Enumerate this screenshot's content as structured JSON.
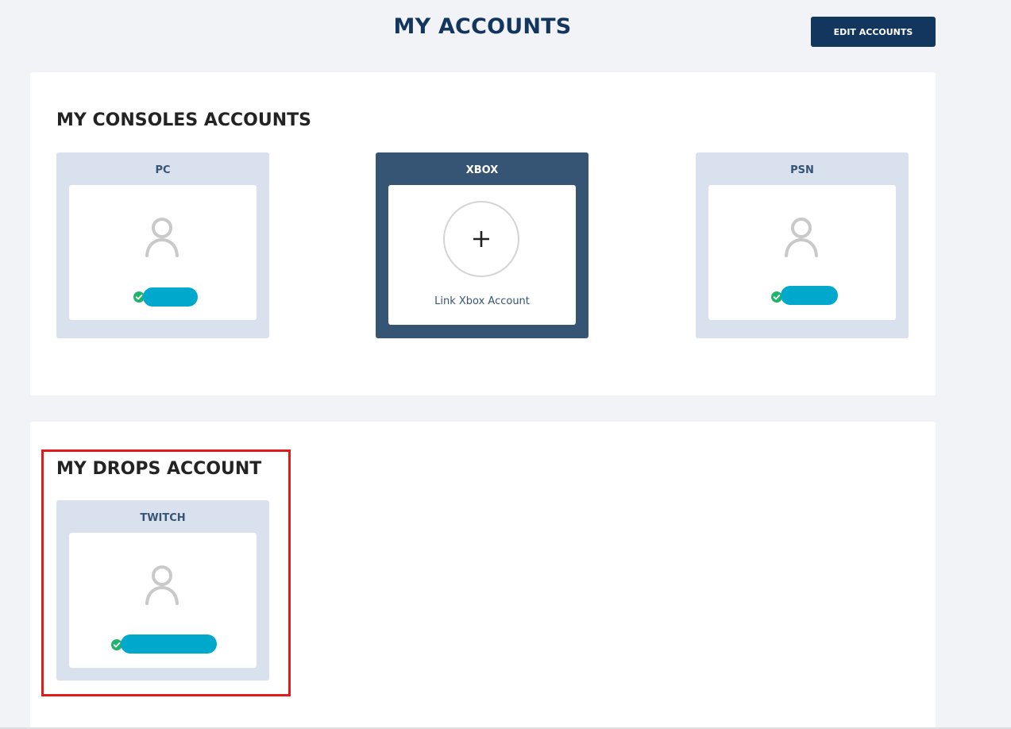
{
  "header": {
    "title": "MY ACCOUNTS",
    "edit_button": "EDIT ACCOUNTS"
  },
  "consoles": {
    "title": "MY CONSOLES ACCOUNTS",
    "cards": [
      {
        "label": "PC",
        "state": "linked",
        "verified_icon": "check-circle-icon"
      },
      {
        "label": "XBOX",
        "state": "unlinked",
        "action_text": "Link Xbox Account",
        "action_icon": "plus-icon"
      },
      {
        "label": "PSN",
        "state": "linked",
        "verified_icon": "check-circle-icon"
      }
    ]
  },
  "drops": {
    "title": "MY DROPS ACCOUNT",
    "cards": [
      {
        "label": "TWITCH",
        "state": "linked",
        "verified_icon": "check-circle-icon"
      }
    ]
  },
  "colors": {
    "brand_navy": "#13365e",
    "card_active": "#365473",
    "card_bg": "#d9e1ee",
    "verified_green": "#1fb46c",
    "redaction_blue": "#00a8cc",
    "highlight_red": "#e01b1b"
  }
}
